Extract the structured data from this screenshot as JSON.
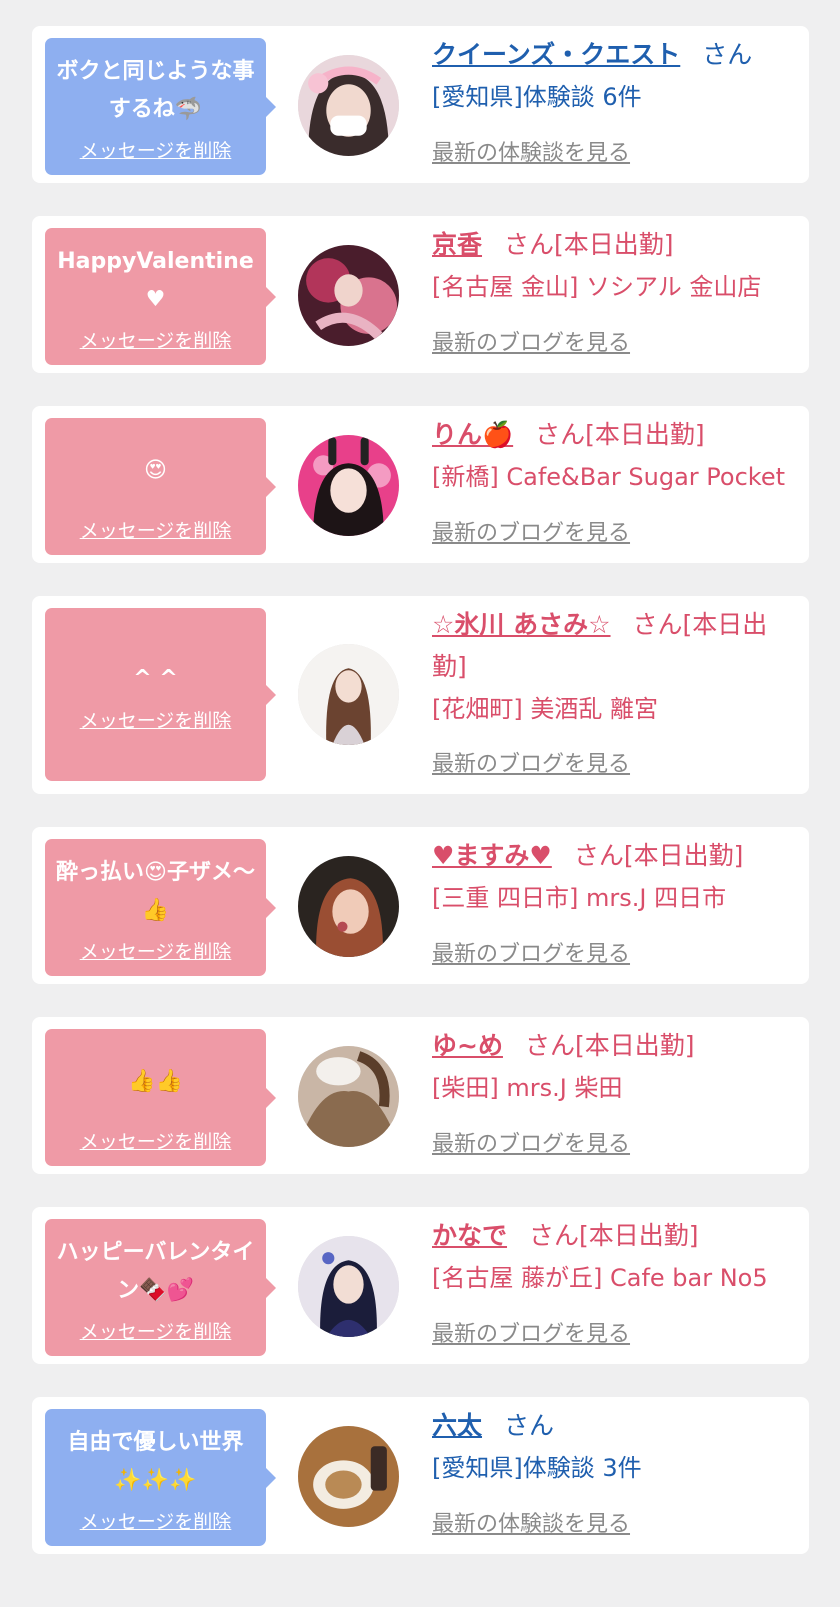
{
  "delete_label": "メッセージを削除",
  "cards": [
    {
      "theme": "blue",
      "message": "ボクと同じような事するね🦈",
      "name": "クイーンズ・クエスト",
      "suffix": "さん",
      "shop": "[愛知県]体験談 6件",
      "latest_link": "最新の体験談を見る",
      "avatar_icon": "profile-photo"
    },
    {
      "theme": "pink",
      "message": "HappyValentine ♥",
      "name": "京香",
      "suffix": "さん[本日出勤]",
      "shop": "[名古屋 金山] ソシアル 金山店",
      "latest_link": "最新のブログを見る",
      "avatar_icon": "profile-photo"
    },
    {
      "theme": "pink",
      "message": "😍",
      "name": "りん🍎",
      "suffix": "さん[本日出勤]",
      "shop": "[新橋] Cafe&Bar Sugar Pocket",
      "latest_link": "最新のブログを見る",
      "avatar_icon": "profile-photo"
    },
    {
      "theme": "pink",
      "message": "^ ^",
      "name": "☆氷川 あさみ☆",
      "suffix": "さん[本日出勤]",
      "shop": "[花畑町] 美酒乱 離宮",
      "latest_link": "最新のブログを見る",
      "avatar_icon": "profile-photo"
    },
    {
      "theme": "pink",
      "message": "酔っ払い😍子ザメ〜👍",
      "name": "♥ますみ♥",
      "suffix": "さん[本日出勤]",
      "shop": "[三重 四日市] mrs.J 四日市",
      "latest_link": "最新のブログを見る",
      "avatar_icon": "profile-photo"
    },
    {
      "theme": "pink",
      "message": "👍👍",
      "name": "ゆ~め",
      "suffix": "さん[本日出勤]",
      "shop": "[柴田] mrs.J 柴田",
      "latest_link": "最新のブログを見る",
      "avatar_icon": "profile-photo"
    },
    {
      "theme": "pink",
      "message": "ハッピーバレンタイン🍫💕",
      "name": "かなで",
      "suffix": "さん[本日出勤]",
      "shop": "[名古屋 藤が丘] Cafe bar No5",
      "latest_link": "最新のブログを見る",
      "avatar_icon": "profile-photo"
    },
    {
      "theme": "blue",
      "message": "自由で優しい世界✨✨✨",
      "name": "六太",
      "suffix": "さん",
      "shop": "[愛知県]体験談 3件",
      "latest_link": "最新の体験談を見る",
      "avatar_icon": "profile-photo"
    }
  ]
}
